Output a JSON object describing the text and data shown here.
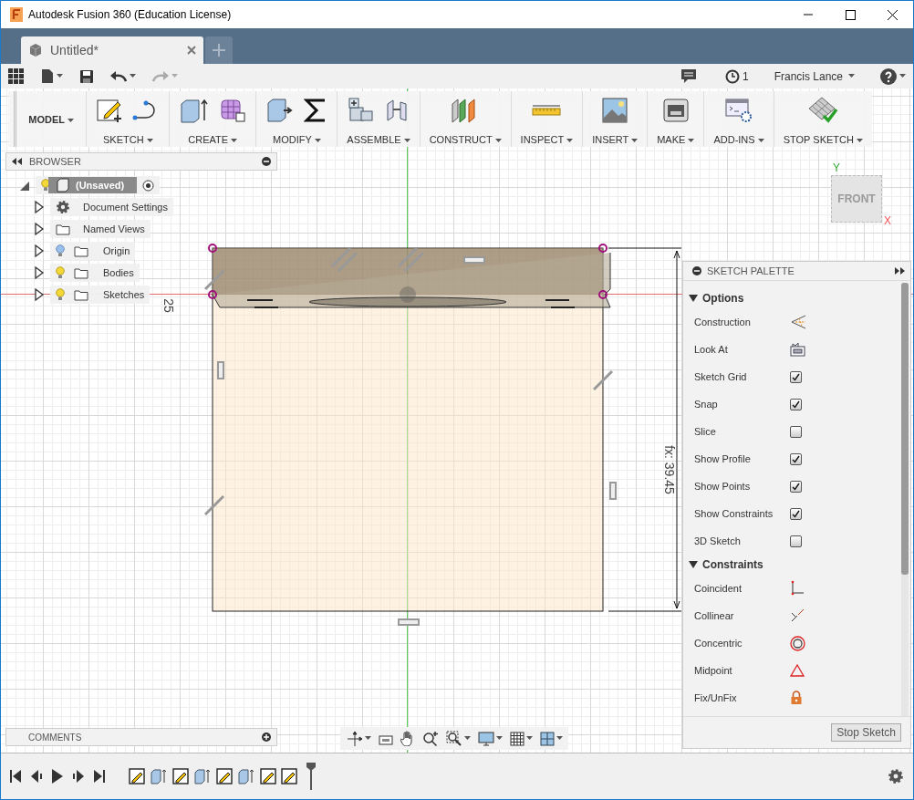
{
  "window": {
    "title": "Autodesk Fusion 360 (Education License)"
  },
  "tabs": [
    {
      "label": "Untitled*",
      "selected": true
    }
  ],
  "quickbar": {
    "job_count": "1",
    "user": "Francis Lance"
  },
  "toolbar": {
    "workspace": "MODEL",
    "groups": [
      {
        "label": "SKETCH"
      },
      {
        "label": "CREATE"
      },
      {
        "label": "MODIFY"
      },
      {
        "label": "ASSEMBLE"
      },
      {
        "label": "CONSTRUCT"
      },
      {
        "label": "INSPECT"
      },
      {
        "label": "INSERT"
      },
      {
        "label": "MAKE"
      },
      {
        "label": "ADD-INS"
      },
      {
        "label": "STOP SKETCH"
      }
    ]
  },
  "browser": {
    "title": "BROWSER",
    "root": {
      "label": "(Unsaved)",
      "expanded": true,
      "visible": true
    },
    "items": [
      {
        "label": "Document Settings",
        "kind": "settings",
        "expanded": false
      },
      {
        "label": "Named Views",
        "kind": "folder",
        "expanded": false
      },
      {
        "label": "Origin",
        "kind": "bulb_folder",
        "expanded": false,
        "visible": false
      },
      {
        "label": "Bodies",
        "kind": "bulb_folder",
        "expanded": false,
        "visible": true
      },
      {
        "label": "Sketches",
        "kind": "bulb_folder",
        "expanded": false,
        "visible": true
      }
    ]
  },
  "canvas": {
    "dimension_vertical": "fx: 39.45",
    "dimension_side": "25",
    "viewcube": {
      "face": "FRONT",
      "x_axis": "X",
      "y_axis": "Y"
    }
  },
  "palette": {
    "title": "SKETCH PALETTE",
    "sections": [
      {
        "title": "Options",
        "expanded": true,
        "items": [
          {
            "label": "Construction",
            "kind": "construction"
          },
          {
            "label": "Look At",
            "kind": "look_at"
          },
          {
            "label": "Sketch Grid",
            "kind": "checkbox",
            "checked": true
          },
          {
            "label": "Snap",
            "kind": "checkbox",
            "checked": true
          },
          {
            "label": "Slice",
            "kind": "checkbox",
            "checked": false
          },
          {
            "label": "Show Profile",
            "kind": "checkbox",
            "checked": true
          },
          {
            "label": "Show Points",
            "kind": "checkbox",
            "checked": true
          },
          {
            "label": "Show Constraints",
            "kind": "checkbox",
            "checked": true
          },
          {
            "label": "3D Sketch",
            "kind": "checkbox",
            "checked": false
          }
        ]
      },
      {
        "title": "Constraints",
        "expanded": true,
        "items": [
          {
            "label": "Coincident",
            "kind": "coincident"
          },
          {
            "label": "Collinear",
            "kind": "collinear"
          },
          {
            "label": "Concentric",
            "kind": "concentric"
          },
          {
            "label": "Midpoint",
            "kind": "midpoint"
          },
          {
            "label": "Fix/UnFix",
            "kind": "fix"
          }
        ]
      }
    ],
    "button": "Stop Sketch"
  },
  "comments": {
    "title": "COMMENTS"
  },
  "timeline": {
    "features": [
      {
        "kind": "sketch"
      },
      {
        "kind": "extrude"
      },
      {
        "kind": "sketch"
      },
      {
        "kind": "extrude"
      },
      {
        "kind": "sketch"
      },
      {
        "kind": "extrude"
      },
      {
        "kind": "sketch"
      },
      {
        "kind": "sketch"
      }
    ]
  }
}
